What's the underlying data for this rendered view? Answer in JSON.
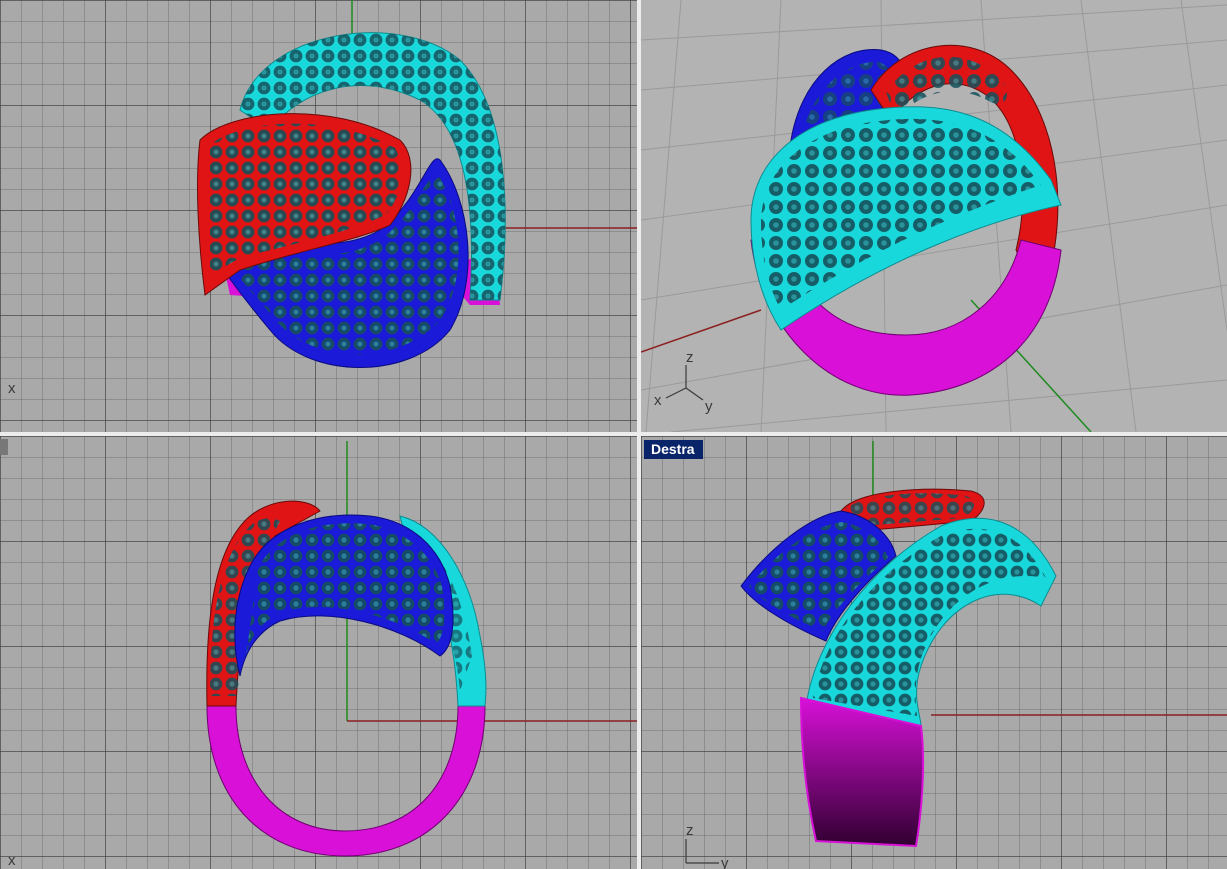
{
  "viewports": {
    "top_left": {
      "axis_label": "x"
    },
    "top_right": {
      "axis_x": "x",
      "axis_y": "y",
      "axis_z": "z"
    },
    "bottom_left": {
      "axis_label": "x"
    },
    "bottom_right": {
      "title": "Destra",
      "axis_z": "z",
      "axis_y": "y"
    }
  },
  "colors": {
    "background": "#a9a9a9",
    "red_band": "#e01414",
    "cyan_band": "#19d8dc",
    "blue_band": "#1a1ad8",
    "magenta_shank": "#d810d8",
    "stone": "#14505a",
    "x_axis": "#8b2020",
    "y_axis": "#1f8a1f"
  }
}
